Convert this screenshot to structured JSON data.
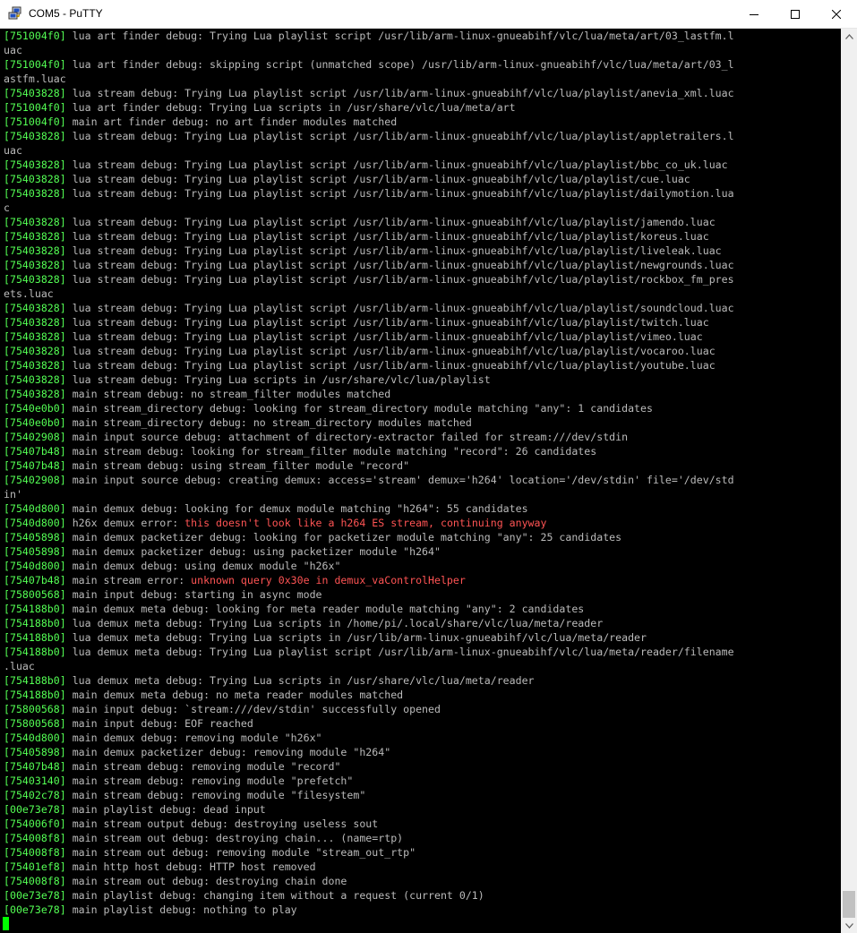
{
  "window": {
    "title": "COM5 - PuTTY"
  },
  "icons": {
    "app": "putty-icon",
    "minimize": "minimize-icon",
    "maximize": "maximize-icon",
    "close": "close-icon",
    "scroll_up": "arrow-up-icon",
    "scroll_down": "arrow-down-icon"
  },
  "colors": {
    "terminal_bg": "#000000",
    "text": "#bbbbbb",
    "address": "#54ff54",
    "error": "#ff5454",
    "cursor": "#00ff00"
  },
  "scrollbar": {
    "position": 1.0
  },
  "terminal": {
    "lines": [
      {
        "addr": "[751004f0]",
        "msg": " lua art finder debug: Trying Lua playlist script /usr/lib/arm-linux-gnueabihf/vlc/lua/meta/art/03_lastfm.l"
      },
      {
        "addr": "",
        "msg": "uac"
      },
      {
        "addr": "[751004f0]",
        "msg": " lua art finder debug: skipping script (unmatched scope) /usr/lib/arm-linux-gnueabihf/vlc/lua/meta/art/03_l"
      },
      {
        "addr": "",
        "msg": "astfm.luac"
      },
      {
        "addr": "[75403828]",
        "msg": " lua stream debug: Trying Lua playlist script /usr/lib/arm-linux-gnueabihf/vlc/lua/playlist/anevia_xml.luac"
      },
      {
        "addr": "[751004f0]",
        "msg": " lua art finder debug: Trying Lua scripts in /usr/share/vlc/lua/meta/art"
      },
      {
        "addr": "[751004f0]",
        "msg": " main art finder debug: no art finder modules matched"
      },
      {
        "addr": "[75403828]",
        "msg": " lua stream debug: Trying Lua playlist script /usr/lib/arm-linux-gnueabihf/vlc/lua/playlist/appletrailers.l"
      },
      {
        "addr": "",
        "msg": "uac"
      },
      {
        "addr": "[75403828]",
        "msg": " lua stream debug: Trying Lua playlist script /usr/lib/arm-linux-gnueabihf/vlc/lua/playlist/bbc_co_uk.luac"
      },
      {
        "addr": "[75403828]",
        "msg": " lua stream debug: Trying Lua playlist script /usr/lib/arm-linux-gnueabihf/vlc/lua/playlist/cue.luac"
      },
      {
        "addr": "[75403828]",
        "msg": " lua stream debug: Trying Lua playlist script /usr/lib/arm-linux-gnueabihf/vlc/lua/playlist/dailymotion.lua"
      },
      {
        "addr": "",
        "msg": "c"
      },
      {
        "addr": "[75403828]",
        "msg": " lua stream debug: Trying Lua playlist script /usr/lib/arm-linux-gnueabihf/vlc/lua/playlist/jamendo.luac"
      },
      {
        "addr": "[75403828]",
        "msg": " lua stream debug: Trying Lua playlist script /usr/lib/arm-linux-gnueabihf/vlc/lua/playlist/koreus.luac"
      },
      {
        "addr": "[75403828]",
        "msg": " lua stream debug: Trying Lua playlist script /usr/lib/arm-linux-gnueabihf/vlc/lua/playlist/liveleak.luac"
      },
      {
        "addr": "[75403828]",
        "msg": " lua stream debug: Trying Lua playlist script /usr/lib/arm-linux-gnueabihf/vlc/lua/playlist/newgrounds.luac"
      },
      {
        "addr": "[75403828]",
        "msg": " lua stream debug: Trying Lua playlist script /usr/lib/arm-linux-gnueabihf/vlc/lua/playlist/rockbox_fm_pres"
      },
      {
        "addr": "",
        "msg": "ets.luac"
      },
      {
        "addr": "[75403828]",
        "msg": " lua stream debug: Trying Lua playlist script /usr/lib/arm-linux-gnueabihf/vlc/lua/playlist/soundcloud.luac"
      },
      {
        "addr": "[75403828]",
        "msg": " lua stream debug: Trying Lua playlist script /usr/lib/arm-linux-gnueabihf/vlc/lua/playlist/twitch.luac"
      },
      {
        "addr": "[75403828]",
        "msg": " lua stream debug: Trying Lua playlist script /usr/lib/arm-linux-gnueabihf/vlc/lua/playlist/vimeo.luac"
      },
      {
        "addr": "[75403828]",
        "msg": " lua stream debug: Trying Lua playlist script /usr/lib/arm-linux-gnueabihf/vlc/lua/playlist/vocaroo.luac"
      },
      {
        "addr": "[75403828]",
        "msg": " lua stream debug: Trying Lua playlist script /usr/lib/arm-linux-gnueabihf/vlc/lua/playlist/youtube.luac"
      },
      {
        "addr": "[75403828]",
        "msg": " lua stream debug: Trying Lua scripts in /usr/share/vlc/lua/playlist"
      },
      {
        "addr": "[75403828]",
        "msg": " main stream debug: no stream_filter modules matched"
      },
      {
        "addr": "[7540e0b0]",
        "msg": " main stream_directory debug: looking for stream_directory module matching \"any\": 1 candidates"
      },
      {
        "addr": "[7540e0b0]",
        "msg": " main stream_directory debug: no stream_directory modules matched"
      },
      {
        "addr": "[75402908]",
        "msg": " main input source debug: attachment of directory-extractor failed for stream:///dev/stdin"
      },
      {
        "addr": "[75407b48]",
        "msg": " main stream debug: looking for stream_filter module matching \"record\": 26 candidates"
      },
      {
        "addr": "[75407b48]",
        "msg": " main stream debug: using stream_filter module \"record\""
      },
      {
        "addr": "[75402908]",
        "msg": " main input source debug: creating demux: access='stream' demux='h264' location='/dev/stdin' file='/dev/std"
      },
      {
        "addr": "",
        "msg": "in'"
      },
      {
        "addr": "[7540d800]",
        "msg": " main demux debug: looking for demux module matching \"h264\": 55 candidates"
      },
      {
        "addr": "[7540d800]",
        "msg": " h26x demux error: ",
        "err": "this doesn't look like a h264 ES stream, continuing anyway"
      },
      {
        "addr": "[75405898]",
        "msg": " main demux packetizer debug: looking for packetizer module matching \"any\": 25 candidates"
      },
      {
        "addr": "[75405898]",
        "msg": " main demux packetizer debug: using packetizer module \"h264\""
      },
      {
        "addr": "[7540d800]",
        "msg": " main demux debug: using demux module \"h26x\""
      },
      {
        "addr": "[75407b48]",
        "msg": " main stream error: ",
        "err": "unknown query 0x30e in demux_vaControlHelper"
      },
      {
        "addr": "[75800568]",
        "msg": " main input debug: starting in async mode"
      },
      {
        "addr": "[754188b0]",
        "msg": " main demux meta debug: looking for meta reader module matching \"any\": 2 candidates"
      },
      {
        "addr": "[754188b0]",
        "msg": " lua demux meta debug: Trying Lua scripts in /home/pi/.local/share/vlc/lua/meta/reader"
      },
      {
        "addr": "[754188b0]",
        "msg": " lua demux meta debug: Trying Lua scripts in /usr/lib/arm-linux-gnueabihf/vlc/lua/meta/reader"
      },
      {
        "addr": "[754188b0]",
        "msg": " lua demux meta debug: Trying Lua playlist script /usr/lib/arm-linux-gnueabihf/vlc/lua/meta/reader/filename"
      },
      {
        "addr": "",
        "msg": ".luac"
      },
      {
        "addr": "[754188b0]",
        "msg": " lua demux meta debug: Trying Lua scripts in /usr/share/vlc/lua/meta/reader"
      },
      {
        "addr": "[754188b0]",
        "msg": " main demux meta debug: no meta reader modules matched"
      },
      {
        "addr": "[75800568]",
        "msg": " main input debug: `stream:///dev/stdin' successfully opened"
      },
      {
        "addr": "[75800568]",
        "msg": " main input debug: EOF reached"
      },
      {
        "addr": "[7540d800]",
        "msg": " main demux debug: removing module \"h26x\""
      },
      {
        "addr": "[75405898]",
        "msg": " main demux packetizer debug: removing module \"h264\""
      },
      {
        "addr": "[75407b48]",
        "msg": " main stream debug: removing module \"record\""
      },
      {
        "addr": "[75403140]",
        "msg": " main stream debug: removing module \"prefetch\""
      },
      {
        "addr": "[75402c78]",
        "msg": " main stream debug: removing module \"filesystem\""
      },
      {
        "addr": "[00e73e78]",
        "msg": " main playlist debug: dead input"
      },
      {
        "addr": "[754006f0]",
        "msg": " main stream output debug: destroying useless sout"
      },
      {
        "addr": "[754008f8]",
        "msg": " main stream out debug: destroying chain... (name=rtp)"
      },
      {
        "addr": "[754008f8]",
        "msg": " main stream out debug: removing module \"stream_out_rtp\""
      },
      {
        "addr": "[75401ef8]",
        "msg": " main http host debug: HTTP host removed"
      },
      {
        "addr": "[754008f8]",
        "msg": " main stream out debug: destroying chain done"
      },
      {
        "addr": "[00e73e78]",
        "msg": " main playlist debug: changing item without a request (current 0/1)"
      },
      {
        "addr": "[00e73e78]",
        "msg": " main playlist debug: nothing to play"
      }
    ]
  }
}
